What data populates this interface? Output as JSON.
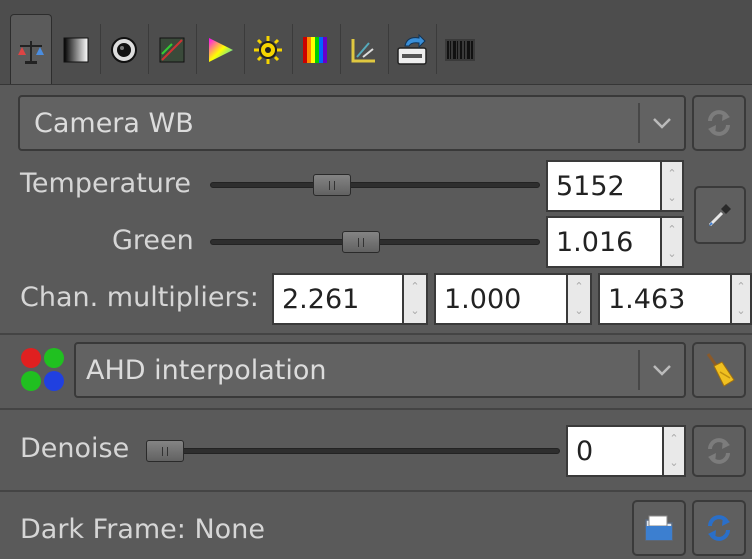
{
  "tabs": [
    {
      "icon": "white-balance-scale-icon"
    },
    {
      "icon": "gradient-square-icon"
    },
    {
      "icon": "lens-circle-icon"
    },
    {
      "icon": "color-square-icon"
    },
    {
      "icon": "color-triangle-icon"
    },
    {
      "icon": "sun-gear-icon"
    },
    {
      "icon": "spectrum-bars-icon"
    },
    {
      "icon": "geometry-icon"
    },
    {
      "icon": "export-save-icon"
    },
    {
      "icon": "barcode-metadata-icon"
    }
  ],
  "white_balance": {
    "preset": "Camera WB",
    "temperature_label": "Temperature",
    "temperature_value": "5152",
    "temperature_level": 0.25,
    "green_label": "Green",
    "green_value": "1.016",
    "green_level": 0.35,
    "chan_label": "Chan. multipliers:",
    "chan_values": [
      "2.261",
      "1.000",
      "1.463"
    ]
  },
  "interpolation": {
    "method": "AHD interpolation"
  },
  "denoise": {
    "label": "Denoise",
    "value": "0",
    "level": 0.0
  },
  "dark_frame": {
    "label": "Dark Frame:",
    "value": "None"
  },
  "colors": {
    "background": "#5a5a5a",
    "input_bg": "#ffffff",
    "accent_blue": "#2a6fc9"
  }
}
